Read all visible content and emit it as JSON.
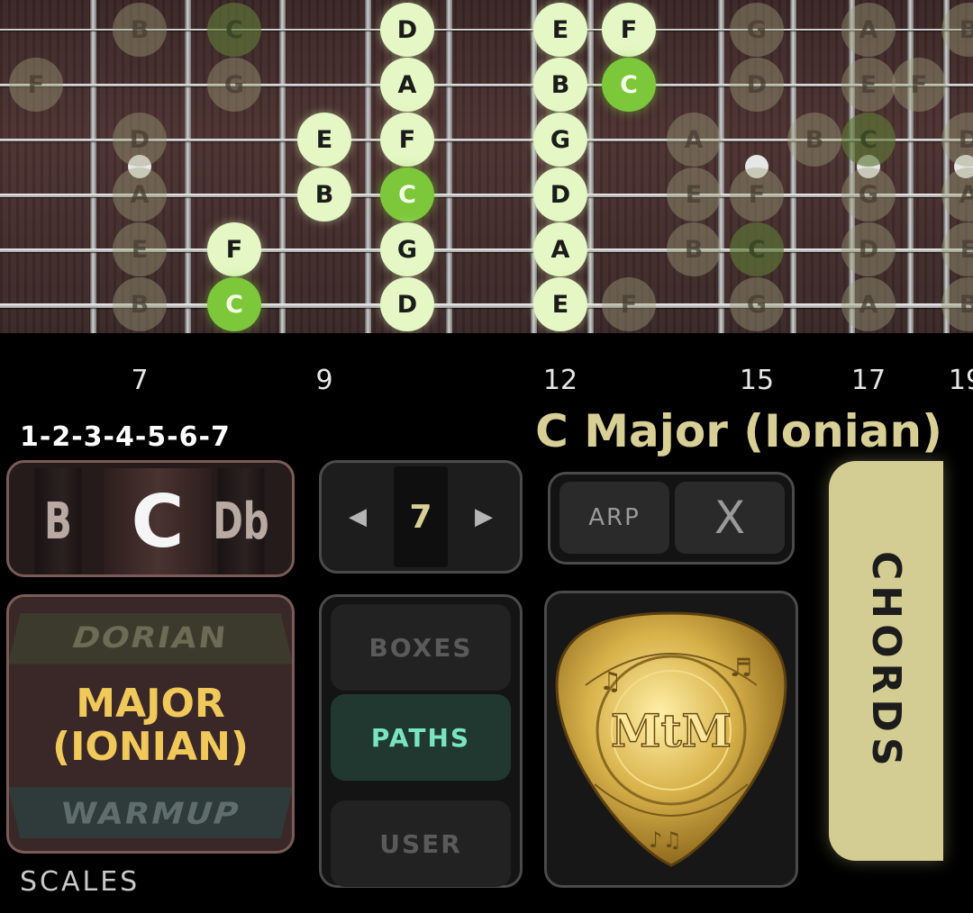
{
  "fretboard": {
    "fret_numbers": [
      "7",
      "9",
      "12",
      "15",
      "17",
      "19"
    ],
    "notes": [
      {
        "s": 1,
        "f": 7,
        "t": "B",
        "st": "dim"
      },
      {
        "s": 1,
        "f": 8,
        "t": "C",
        "st": "dimroot"
      },
      {
        "s": 1,
        "f": 10,
        "t": "D",
        "st": "active"
      },
      {
        "s": 1,
        "f": 12,
        "t": "E",
        "st": "active"
      },
      {
        "s": 1,
        "f": 13,
        "t": "F",
        "st": "active"
      },
      {
        "s": 1,
        "f": 15,
        "t": "G",
        "st": "dim"
      },
      {
        "s": 1,
        "f": 17,
        "t": "A",
        "st": "dim"
      },
      {
        "s": 1,
        "f": 19,
        "t": "B",
        "st": "dim"
      },
      {
        "s": 2,
        "f": 5,
        "t": "F",
        "st": "dim"
      },
      {
        "s": 2,
        "f": 8,
        "t": "G",
        "st": "dim"
      },
      {
        "s": 2,
        "f": 10,
        "t": "A",
        "st": "active"
      },
      {
        "s": 2,
        "f": 12,
        "t": "B",
        "st": "active"
      },
      {
        "s": 2,
        "f": 13,
        "t": "C",
        "st": "root"
      },
      {
        "s": 2,
        "f": 15,
        "t": "D",
        "st": "dim"
      },
      {
        "s": 2,
        "f": 17,
        "t": "E",
        "st": "dim"
      },
      {
        "s": 2,
        "f": 18,
        "t": "F",
        "st": "dim"
      },
      {
        "s": 3,
        "f": 7,
        "t": "D",
        "st": "dim"
      },
      {
        "s": 3,
        "f": 9,
        "t": "E",
        "st": "active"
      },
      {
        "s": 3,
        "f": 10,
        "t": "F",
        "st": "active"
      },
      {
        "s": 3,
        "f": 12,
        "t": "G",
        "st": "active"
      },
      {
        "s": 3,
        "f": 14,
        "t": "A",
        "st": "dim"
      },
      {
        "s": 3,
        "f": 16,
        "t": "B",
        "st": "dim"
      },
      {
        "s": 3,
        "f": 17,
        "t": "C",
        "st": "dimroot"
      },
      {
        "s": 3,
        "f": 19,
        "t": "D",
        "st": "dim"
      },
      {
        "s": 4,
        "f": 7,
        "t": "A",
        "st": "dim"
      },
      {
        "s": 4,
        "f": 9,
        "t": "B",
        "st": "active"
      },
      {
        "s": 4,
        "f": 10,
        "t": "C",
        "st": "root"
      },
      {
        "s": 4,
        "f": 12,
        "t": "D",
        "st": "active"
      },
      {
        "s": 4,
        "f": 14,
        "t": "E",
        "st": "dim"
      },
      {
        "s": 4,
        "f": 15,
        "t": "F",
        "st": "dim"
      },
      {
        "s": 4,
        "f": 17,
        "t": "G",
        "st": "dim"
      },
      {
        "s": 4,
        "f": 19,
        "t": "A",
        "st": "dim"
      },
      {
        "s": 5,
        "f": 7,
        "t": "E",
        "st": "dim"
      },
      {
        "s": 5,
        "f": 8,
        "t": "F",
        "st": "active"
      },
      {
        "s": 5,
        "f": 10,
        "t": "G",
        "st": "active"
      },
      {
        "s": 5,
        "f": 12,
        "t": "A",
        "st": "active"
      },
      {
        "s": 5,
        "f": 14,
        "t": "B",
        "st": "dim"
      },
      {
        "s": 5,
        "f": 15,
        "t": "C",
        "st": "dimroot"
      },
      {
        "s": 5,
        "f": 17,
        "t": "D",
        "st": "dim"
      },
      {
        "s": 5,
        "f": 19,
        "t": "E",
        "st": "dim"
      },
      {
        "s": 6,
        "f": 7,
        "t": "B",
        "st": "dim"
      },
      {
        "s": 6,
        "f": 8,
        "t": "C",
        "st": "root"
      },
      {
        "s": 6,
        "f": 10,
        "t": "D",
        "st": "active"
      },
      {
        "s": 6,
        "f": 12,
        "t": "E",
        "st": "active"
      },
      {
        "s": 6,
        "f": 13,
        "t": "F",
        "st": "dim"
      },
      {
        "s": 6,
        "f": 15,
        "t": "G",
        "st": "dim"
      },
      {
        "s": 6,
        "f": 17,
        "t": "A",
        "st": "dim"
      },
      {
        "s": 6,
        "f": 19,
        "t": "B",
        "st": "dim"
      }
    ]
  },
  "formula": "1-2-3-4-5-6-7",
  "scale_title": "C Major (Ionian)",
  "key_selector": {
    "prev": "B",
    "current": "C",
    "next": "Db"
  },
  "position_selector": {
    "value": "7",
    "left_icon": "triangle-left-icon",
    "right_icon": "triangle-right-icon"
  },
  "arp_panel": {
    "arp_label": "ARP",
    "close_label": "X"
  },
  "mode_selector": {
    "prev": "DORIAN",
    "current": "MAJOR (IONIAN)",
    "next": "WARMUP"
  },
  "view_selector": {
    "boxes": "BOXES",
    "paths": "PATHS",
    "user": "USER",
    "selected": "PATHS"
  },
  "logo": {
    "text": "MtM"
  },
  "chords_button": {
    "label": "CHORDS"
  },
  "scales_label": "SCALES",
  "colors": {
    "accent": "#d8cf96",
    "root_note": "#7cc83a",
    "active_note": "#e4f7c4",
    "paths_text": "#78e4c0",
    "mode_text": "#f0c95a"
  }
}
